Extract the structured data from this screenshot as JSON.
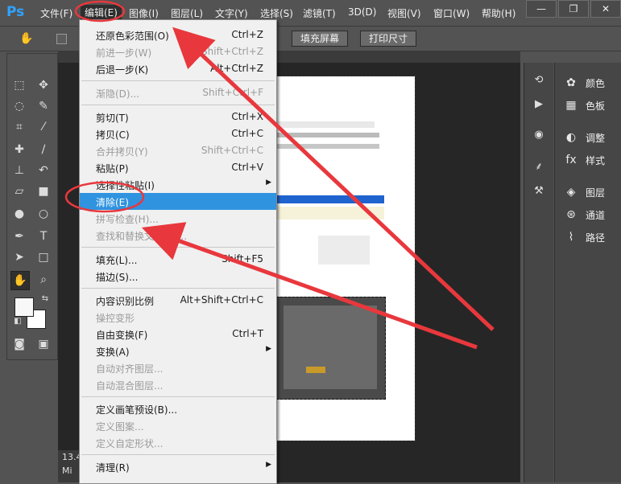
{
  "app": {
    "logo": "Ps"
  },
  "menubar": {
    "items": [
      "文件(F)",
      "编辑(E)",
      "图像(I)",
      "图层(L)",
      "文字(Y)",
      "选择(S)",
      "滤镜(T)",
      "3D(D)",
      "视图(V)",
      "窗口(W)",
      "帮助(H)"
    ],
    "active": "编辑(E)"
  },
  "window_controls": {
    "minimize": "—",
    "restore": "❐",
    "close": "✕"
  },
  "options_bar": {
    "fill_screen": "填充屏幕",
    "print_size": "打印尺寸"
  },
  "edit_menu": {
    "items": [
      {
        "label": "还原色彩范围(O)",
        "shortcut": "Ctrl+Z",
        "state": "enabled"
      },
      {
        "label": "前进一步(W)",
        "shortcut": "Shift+Ctrl+Z",
        "state": "disabled"
      },
      {
        "label": "后退一步(K)",
        "shortcut": "Alt+Ctrl+Z",
        "state": "enabled"
      },
      {
        "label": "渐隐(D)...",
        "shortcut": "Shift+Ctrl+F",
        "state": "disabled"
      },
      {
        "label": "剪切(T)",
        "shortcut": "Ctrl+X",
        "state": "enabled"
      },
      {
        "label": "拷贝(C)",
        "shortcut": "Ctrl+C",
        "state": "enabled"
      },
      {
        "label": "合并拷贝(Y)",
        "shortcut": "Shift+Ctrl+C",
        "state": "disabled"
      },
      {
        "label": "粘贴(P)",
        "shortcut": "Ctrl+V",
        "state": "enabled"
      },
      {
        "label": "选择性粘贴(I)",
        "shortcut": "",
        "state": "enabled",
        "submenu": true
      },
      {
        "label": "清除(E)",
        "shortcut": "",
        "state": "highlighted"
      },
      {
        "label": "拼写检查(H)...",
        "shortcut": "",
        "state": "disabled"
      },
      {
        "label": "查找和替换文本(X)...",
        "shortcut": "",
        "state": "disabled"
      },
      {
        "label": "填充(L)...",
        "shortcut": "Shift+F5",
        "state": "enabled"
      },
      {
        "label": "描边(S)...",
        "shortcut": "",
        "state": "enabled"
      },
      {
        "label": "内容识别比例",
        "shortcut": "Alt+Shift+Ctrl+C",
        "state": "enabled"
      },
      {
        "label": "操控变形",
        "shortcut": "",
        "state": "disabled"
      },
      {
        "label": "自由变换(F)",
        "shortcut": "Ctrl+T",
        "state": "enabled"
      },
      {
        "label": "变换(A)",
        "shortcut": "",
        "state": "enabled",
        "submenu": true
      },
      {
        "label": "自动对齐图层...",
        "shortcut": "",
        "state": "disabled"
      },
      {
        "label": "自动混合图层...",
        "shortcut": "",
        "state": "disabled"
      },
      {
        "label": "定义画笔预设(B)...",
        "shortcut": "",
        "state": "enabled"
      },
      {
        "label": "定义图案...",
        "shortcut": "",
        "state": "disabled"
      },
      {
        "label": "定义自定形状...",
        "shortcut": "",
        "state": "disabled"
      },
      {
        "label": "清理(R)",
        "shortcut": "",
        "state": "enabled",
        "submenu": true
      }
    ]
  },
  "right_panels": [
    {
      "label": "颜色",
      "icon": "palette-icon"
    },
    {
      "label": "色板",
      "icon": "swatches-icon"
    },
    {
      "label": "调整",
      "icon": "adjustments-icon"
    },
    {
      "label": "样式",
      "icon": "styles-icon"
    },
    {
      "label": "图层",
      "icon": "layers-icon"
    },
    {
      "label": "通道",
      "icon": "channels-icon"
    },
    {
      "label": "路径",
      "icon": "paths-icon"
    }
  ],
  "status": {
    "zoom": "13.4",
    "doc_prefix": "Mi"
  },
  "colors": {
    "highlight": "#2f93e0",
    "annotation": "#e8383d",
    "logo": "#2fa3ff"
  }
}
